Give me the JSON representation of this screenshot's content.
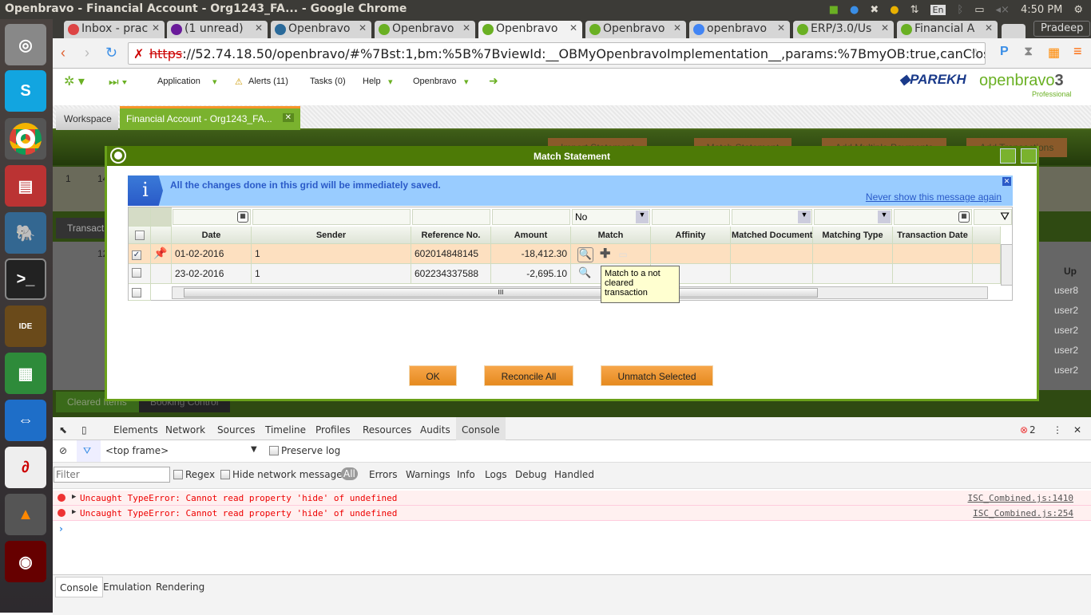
{
  "window": {
    "title": "Openbravo - Financial Account - Org1243_FA... - Google Chrome",
    "clock": "4:50 PM",
    "keyboard": "En"
  },
  "browser": {
    "tabs": [
      {
        "label": "Inbox - prac"
      },
      {
        "label": "(1 unread)"
      },
      {
        "label": "Openbravo"
      },
      {
        "label": "Openbravo"
      },
      {
        "label": "Openbravo"
      },
      {
        "label": "Openbravo"
      },
      {
        "label": "openbravo"
      },
      {
        "label": "ERP/3.0/Us"
      },
      {
        "label": "Financial A"
      }
    ],
    "profile": "Pradeep",
    "url_scheme": "https",
    "url_rest": "://52.74.18.50/openbravo/#%7Bst:1,bm:%5B%7BviewId:__OBMyOpenbravoImplementation__,params:%7BmyOB:true,canClose:false,tabTi"
  },
  "app": {
    "nav": {
      "application": "Application",
      "alerts": "Alerts (11)",
      "tasks": "Tasks (0)",
      "help": "Help",
      "user": "Openbravo"
    },
    "logos": {
      "company": "PAREKH",
      "product": "openbravo",
      "edition": "Professional",
      "version": "3"
    },
    "tabs": [
      {
        "label": "Workspace"
      },
      {
        "label": "Financial Account - Org1243_FA..."
      }
    ],
    "background": {
      "toolbar_buttons": [
        "Import Statement",
        "Match Statement",
        "Add Multiple Payments",
        "Add Transactions"
      ],
      "tab_transactions": "Transact",
      "tab_cleared": "Cleared Items",
      "tab_booking": "Booking Control",
      "col_up": "Up",
      "users": [
        "user8",
        "user2",
        "user2",
        "user2",
        "user2"
      ],
      "num1": "1",
      "num2": "14",
      "num3": "12"
    }
  },
  "dialog": {
    "title": "Match Statement",
    "info_message": "All the changes done in this grid will be immediately saved.",
    "never_show": "Never show this message again",
    "filter_match": "No",
    "columns": [
      "Date",
      "Sender",
      "Reference No.",
      "Amount",
      "Match",
      "Affinity",
      "Matched Document",
      "Matching Type",
      "Transaction Date"
    ],
    "rows": [
      {
        "date": "01-02-2016",
        "sender": "1",
        "reference": "602014848145",
        "amount": "-18,412.30",
        "selected": true
      },
      {
        "date": "23-02-2016",
        "sender": "1",
        "reference": "602234337588",
        "amount": "-2,695.10",
        "selected": false
      }
    ],
    "tooltip": "Match to a not cleared transaction",
    "buttons": {
      "ok": "OK",
      "reconcile_all": "Reconcile All",
      "unmatch_selected": "Unmatch Selected"
    }
  },
  "devtools": {
    "tabs": [
      "Elements",
      "Network",
      "Sources",
      "Timeline",
      "Profiles",
      "Resources",
      "Audits",
      "Console"
    ],
    "error_count": "2",
    "context": "<top frame>",
    "preserve_log": "Preserve log",
    "filter_placeholder": "Filter",
    "regex": "Regex",
    "hide_network": "Hide network messages",
    "levels": [
      "All",
      "Errors",
      "Warnings",
      "Info",
      "Logs",
      "Debug",
      "Handled"
    ],
    "messages": [
      {
        "text": "Uncaught TypeError: Cannot read property 'hide' of undefined",
        "source": "ISC_Combined.js:1410"
      },
      {
        "text": "Uncaught TypeError: Cannot read property 'hide' of undefined",
        "source": "ISC_Combined.js:254"
      }
    ],
    "prompt": "›",
    "drawer_tabs": [
      "Console",
      "Emulation",
      "Rendering"
    ]
  }
}
